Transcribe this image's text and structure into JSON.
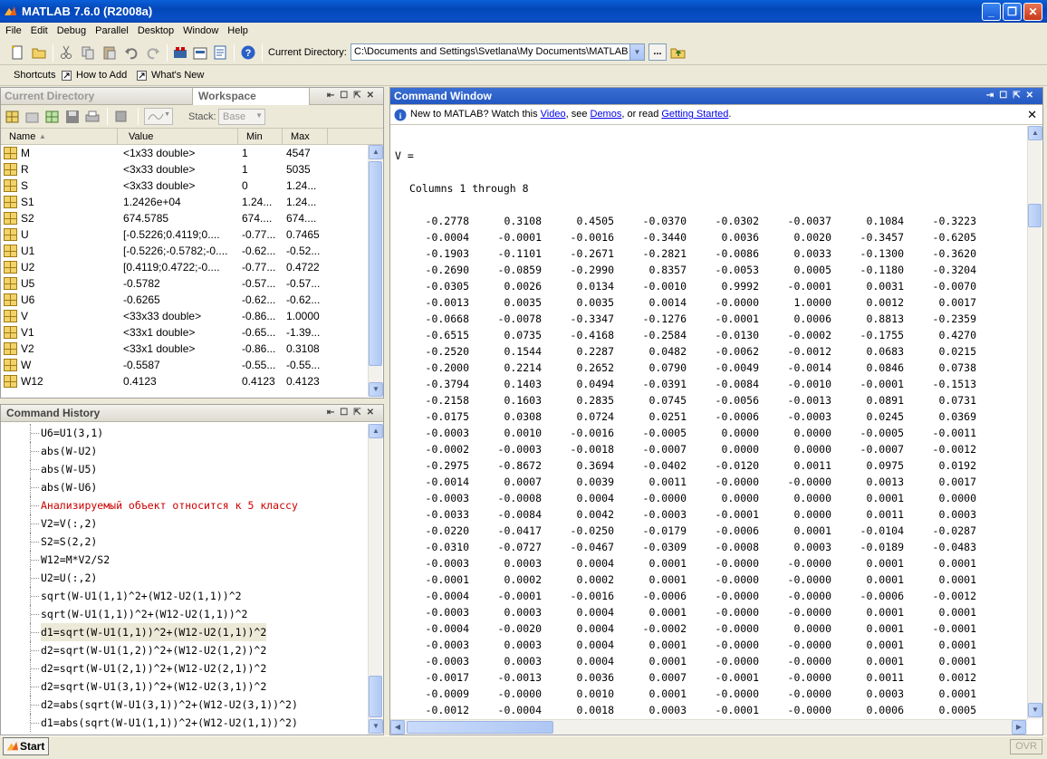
{
  "window": {
    "title": "MATLAB  7.6.0 (R2008a)"
  },
  "menu": [
    "File",
    "Edit",
    "Debug",
    "Parallel",
    "Desktop",
    "Window",
    "Help"
  ],
  "toolbar": {
    "curdir_label": "Current Directory:",
    "curdir_value": "C:\\Documents and Settings\\Svetlana\\My Documents\\MATLAB",
    "browse_label": "..."
  },
  "shortcuts": {
    "shortcuts": "Shortcuts",
    "how_to_add": "How to Add",
    "whats_new": "What's New"
  },
  "left_top": {
    "tab_current_dir": "Current Directory",
    "tab_workspace": "Workspace",
    "stack_label": "Stack:",
    "stack_value": "Base",
    "columns": [
      "Name",
      "Value",
      "Min",
      "Max"
    ],
    "rows": [
      [
        "M",
        "<1x33 double>",
        "1",
        "4547"
      ],
      [
        "R",
        "<3x33 double>",
        "1",
        "5035"
      ],
      [
        "S",
        "<3x33 double>",
        "0",
        "1.24..."
      ],
      [
        "S1",
        "1.2426e+04",
        "1.24...",
        "1.24..."
      ],
      [
        "S2",
        "674.5785",
        "674....",
        "674...."
      ],
      [
        "U",
        "[-0.5226;0.4119;0....",
        "-0.77...",
        "0.7465"
      ],
      [
        "U1",
        "[-0.5226;-0.5782;-0....",
        "-0.62...",
        "-0.52..."
      ],
      [
        "U2",
        "[0.4119;0.4722;-0....",
        "-0.77...",
        "0.4722"
      ],
      [
        "U5",
        "-0.5782",
        "-0.57...",
        "-0.57..."
      ],
      [
        "U6",
        "-0.6265",
        "-0.62...",
        "-0.62..."
      ],
      [
        "V",
        "<33x33 double>",
        "-0.86...",
        "1.0000"
      ],
      [
        "V1",
        "<33x1 double>",
        "-0.65...",
        "-1.39..."
      ],
      [
        "V2",
        "<33x1 double>",
        "-0.86...",
        "0.3108"
      ],
      [
        "W",
        "-0.5587",
        "-0.55...",
        "-0.55..."
      ],
      [
        "W12",
        "0.4123",
        "0.4123",
        "0.4123"
      ]
    ]
  },
  "history": {
    "title": "Command History",
    "lines": [
      {
        "text": "U6=U1(3,1)",
        "color": "#000000"
      },
      {
        "text": "abs(W-U2)",
        "color": "#000000"
      },
      {
        "text": "abs(W-U5)",
        "color": "#000000"
      },
      {
        "text": "abs(W-U6)",
        "color": "#000000"
      },
      {
        "text": "Анализируемый объект относится к 5 классу",
        "color": "#cc0000"
      },
      {
        "text": "V2=V(:,2)",
        "color": "#000000"
      },
      {
        "text": "S2=S(2,2)",
        "color": "#000000"
      },
      {
        "text": "W12=M*V2/S2",
        "color": "#000000"
      },
      {
        "text": "U2=U(:,2)",
        "color": "#000000"
      },
      {
        "text": "sqrt(W-U1(1,1)^2+(W12-U2(1,1))^2",
        "color": "#000000"
      },
      {
        "text": "sqrt(W-U1(1,1))^2+(W12-U2(1,1))^2",
        "color": "#000000"
      },
      {
        "text": "d1=sqrt(W-U1(1,1))^2+(W12-U2(1,1))^2",
        "color": "#000000"
      },
      {
        "text": "d2=sqrt(W-U1(1,2))^2+(W12-U2(1,2))^2",
        "color": "#000000"
      },
      {
        "text": "d2=sqrt(W-U1(2,1))^2+(W12-U2(2,1))^2",
        "color": "#000000"
      },
      {
        "text": "d2=sqrt(W-U1(3,1))^2+(W12-U2(3,1))^2",
        "color": "#000000"
      },
      {
        "text": "d2=abs(sqrt(W-U1(3,1))^2+(W12-U2(3,1))^2)",
        "color": "#000000"
      },
      {
        "text": "d1=abs(sqrt(W-U1(1,1))^2+(W12-U2(1,1))^2)",
        "color": "#000000"
      }
    ]
  },
  "command": {
    "title": "Command Window",
    "info_prefix": "New to MATLAB? Watch this ",
    "info_video": "Video",
    "info_mid1": ", see ",
    "info_demos": "Demos",
    "info_mid2": ", or read ",
    "info_started": "Getting Started",
    "info_end": ".",
    "var_line": "V =",
    "cols_line": "Columns 1 through 8",
    "rows": [
      [
        "-0.2778",
        "0.3108",
        "0.4505",
        "-0.0370",
        "-0.0302",
        "-0.0037",
        "0.1084",
        "-0.3223"
      ],
      [
        "-0.0004",
        "-0.0001",
        "-0.0016",
        "-0.3440",
        "0.0036",
        "0.0020",
        "-0.3457",
        "-0.6205"
      ],
      [
        "-0.1903",
        "-0.1101",
        "-0.2671",
        "-0.2821",
        "-0.0086",
        "0.0033",
        "-0.1300",
        "-0.3620"
      ],
      [
        "-0.2690",
        "-0.0859",
        "-0.2990",
        "0.8357",
        "-0.0053",
        "0.0005",
        "-0.1180",
        "-0.3204"
      ],
      [
        "-0.0305",
        "0.0026",
        "0.0134",
        "-0.0010",
        "0.9992",
        "-0.0001",
        "0.0031",
        "-0.0070"
      ],
      [
        "-0.0013",
        "0.0035",
        "0.0035",
        "0.0014",
        "-0.0000",
        "1.0000",
        "0.0012",
        "0.0017"
      ],
      [
        "-0.0668",
        "-0.0078",
        "-0.3347",
        "-0.1276",
        "-0.0001",
        "0.0006",
        "0.8813",
        "-0.2359"
      ],
      [
        "-0.6515",
        "0.0735",
        "-0.4168",
        "-0.2584",
        "-0.0130",
        "-0.0002",
        "-0.1755",
        "0.4270"
      ],
      [
        "-0.2520",
        "0.1544",
        "0.2287",
        "0.0482",
        "-0.0062",
        "-0.0012",
        "0.0683",
        "0.0215"
      ],
      [
        "-0.2000",
        "0.2214",
        "0.2652",
        "0.0790",
        "-0.0049",
        "-0.0014",
        "0.0846",
        "0.0738"
      ],
      [
        "-0.3794",
        "0.1403",
        "0.0494",
        "-0.0391",
        "-0.0084",
        "-0.0010",
        "-0.0001",
        "-0.1513"
      ],
      [
        "-0.2158",
        "0.1603",
        "0.2835",
        "0.0745",
        "-0.0056",
        "-0.0013",
        "0.0891",
        "0.0731"
      ],
      [
        "-0.0175",
        "0.0308",
        "0.0724",
        "0.0251",
        "-0.0006",
        "-0.0003",
        "0.0245",
        "0.0369"
      ],
      [
        "-0.0003",
        "0.0010",
        "-0.0016",
        "-0.0005",
        "0.0000",
        "0.0000",
        "-0.0005",
        "-0.0011"
      ],
      [
        "-0.0002",
        "-0.0003",
        "-0.0018",
        "-0.0007",
        "0.0000",
        "0.0000",
        "-0.0007",
        "-0.0012"
      ],
      [
        "-0.2975",
        "-0.8672",
        "0.3694",
        "-0.0402",
        "-0.0120",
        "0.0011",
        "0.0975",
        "0.0192"
      ],
      [
        "-0.0014",
        "0.0007",
        "0.0039",
        "0.0011",
        "-0.0000",
        "-0.0000",
        "0.0013",
        "0.0017"
      ],
      [
        "-0.0003",
        "-0.0008",
        "0.0004",
        "-0.0000",
        "0.0000",
        "0.0000",
        "0.0001",
        "0.0000"
      ],
      [
        "-0.0033",
        "-0.0084",
        "0.0042",
        "-0.0003",
        "-0.0001",
        "0.0000",
        "0.0011",
        "0.0003"
      ],
      [
        "-0.0220",
        "-0.0417",
        "-0.0250",
        "-0.0179",
        "-0.0006",
        "0.0001",
        "-0.0104",
        "-0.0287"
      ],
      [
        "-0.0310",
        "-0.0727",
        "-0.0467",
        "-0.0309",
        "-0.0008",
        "0.0003",
        "-0.0189",
        "-0.0483"
      ],
      [
        "-0.0003",
        "0.0003",
        "0.0004",
        "0.0001",
        "-0.0000",
        "-0.0000",
        "0.0001",
        "0.0001"
      ],
      [
        "-0.0001",
        "0.0002",
        "0.0002",
        "0.0001",
        "-0.0000",
        "-0.0000",
        "0.0001",
        "0.0001"
      ],
      [
        "-0.0004",
        "-0.0001",
        "-0.0016",
        "-0.0006",
        "-0.0000",
        "-0.0000",
        "-0.0006",
        "-0.0012"
      ],
      [
        "-0.0003",
        "0.0003",
        "0.0004",
        "0.0001",
        "-0.0000",
        "-0.0000",
        "0.0001",
        "0.0001"
      ],
      [
        "-0.0004",
        "-0.0020",
        "0.0004",
        "-0.0002",
        "-0.0000",
        "0.0000",
        "0.0001",
        "-0.0001"
      ],
      [
        "-0.0003",
        "0.0003",
        "0.0004",
        "0.0001",
        "-0.0000",
        "-0.0000",
        "0.0001",
        "0.0001"
      ],
      [
        "-0.0003",
        "0.0003",
        "0.0004",
        "0.0001",
        "-0.0000",
        "-0.0000",
        "0.0001",
        "0.0001"
      ],
      [
        "-0.0017",
        "-0.0013",
        "0.0036",
        "0.0007",
        "-0.0001",
        "-0.0000",
        "0.0011",
        "0.0012"
      ],
      [
        "-0.0009",
        "-0.0000",
        "0.0010",
        "0.0001",
        "-0.0000",
        "-0.0000",
        "0.0003",
        "0.0001"
      ],
      [
        "-0.0012",
        "-0.0004",
        "0.0018",
        "0.0003",
        "-0.0001",
        "-0.0000",
        "0.0006",
        "0.0005"
      ]
    ]
  },
  "taskbar": {
    "start": "Start",
    "ovr": "OVR"
  }
}
